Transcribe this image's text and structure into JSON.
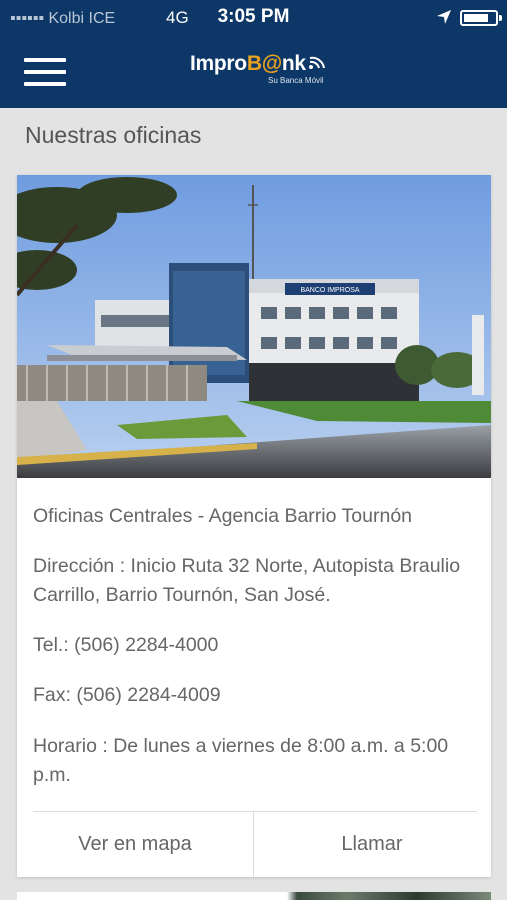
{
  "status_bar": {
    "carrier": "▪▪▪▪▪▪ Kolbi ICE",
    "network": "4G",
    "time": "3:05 PM"
  },
  "header": {
    "logo_prefix": "Impro",
    "logo_at": "B@",
    "logo_suffix": "nk",
    "logo_tagline": "Su Banca Móvil",
    "colors": {
      "background": "#0d3766",
      "accent": "#e8a21f"
    }
  },
  "page": {
    "title": "Nuestras oficinas"
  },
  "office": {
    "name": "Oficinas Centrales - Agencia Barrio Tournón",
    "address": "Dirección : Inicio Ruta 32 Norte, Autopista Braulio Carrillo, Barrio Tournón, San José.",
    "phone": "Tel.: (506) 2284-4000",
    "fax": "Fax: (506) 2284-4009",
    "hours": "Horario : De lunes a viernes de 8:00 a.m. a 5:00 p.m.",
    "building_sign": "BANCO IMPROSA",
    "photo_icon": "office-building-photo"
  },
  "actions": {
    "map_label": "Ver en mapa",
    "call_label": "Llamar"
  }
}
